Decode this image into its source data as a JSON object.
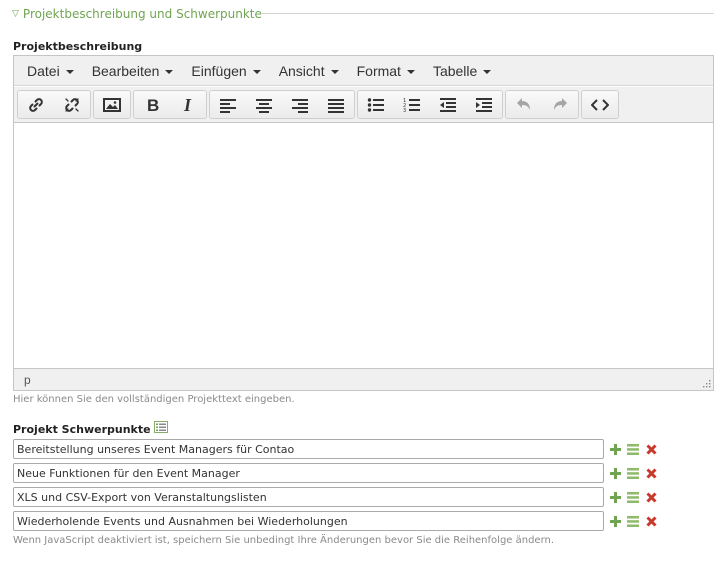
{
  "legend": {
    "title": "Projektbeschreibung und Schwerpunkte"
  },
  "description": {
    "label": "Projektbeschreibung",
    "menu": [
      "Datei",
      "Bearbeiten",
      "Einfügen",
      "Ansicht",
      "Format",
      "Tabelle"
    ],
    "toolbar_icons": [
      [
        "link-icon",
        "unlink-icon"
      ],
      [
        "image-icon"
      ],
      [
        "bold-icon",
        "italic-icon"
      ],
      [
        "align-left-icon",
        "align-center-icon",
        "align-right-icon",
        "align-justify-icon"
      ],
      [
        "bullet-list-icon",
        "numbered-list-icon",
        "outdent-icon",
        "indent-icon"
      ],
      [
        "undo-icon",
        "redo-icon"
      ],
      [
        "source-code-icon"
      ]
    ],
    "content": "",
    "status_path": "p",
    "tip": "Hier können Sie den vollständigen Projekttext eingeben."
  },
  "focus": {
    "label": "Projekt Schwerpunkte",
    "items": [
      "Bereitstellung unseres Event Managers für Contao",
      "Neue Funktionen für den Event Manager",
      "XLS und CSV-Export von Veranstaltungslisten",
      "Wiederholende Events und Ausnahmen bei Wiederholungen"
    ],
    "tip": "Wenn JavaScript deaktiviert ist, speichern Sie unbedingt Ihre Änderungen bevor Sie die Reihenfolge ändern."
  },
  "colors": {
    "accent_green": "#6fa552",
    "delete_red": "#c8392b",
    "border": "#c5c5c5"
  }
}
